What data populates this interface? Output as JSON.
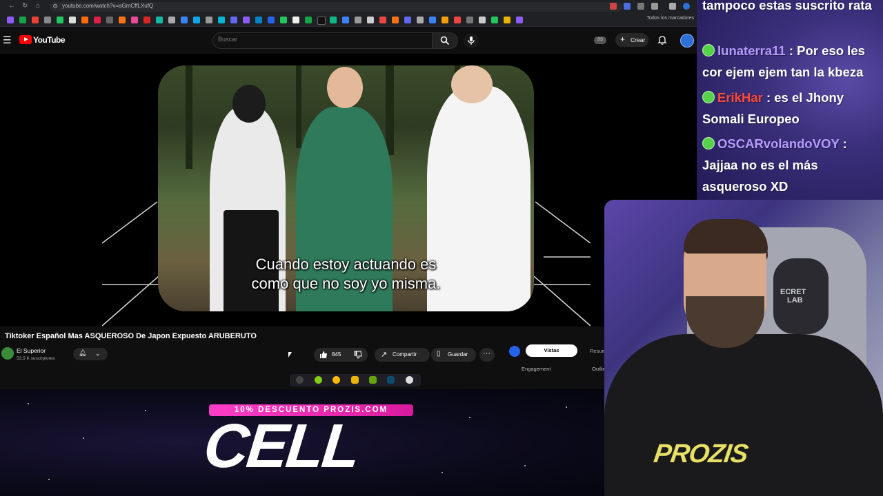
{
  "browser": {
    "url": "youtube.com/watch?v=aGmCffLXufQ",
    "bookmarks_label": "Todos los marcadores"
  },
  "youtube": {
    "logo_text": "YouTube",
    "search_placeholder": "Buscar",
    "ss_badge": "SS",
    "create_label": "Crear"
  },
  "video": {
    "subtitle_line1": "Cuando estoy actuando es",
    "subtitle_line2": "como que no soy yo misma.",
    "title": "Tiktoker Español Mas ASQUEROSO De Japon Expuesto ARUBERUTO"
  },
  "channel": {
    "name": "El Superior",
    "subscribers": "53,5 K suscriptores"
  },
  "actions": {
    "likes": "845",
    "share_label": "Compartir",
    "save_label": "Guardar"
  },
  "side_panel": {
    "tab_active": "Vistas",
    "tab_other": "Resum",
    "engagement": "Engagement",
    "outline": "Outlie"
  },
  "chat": {
    "messages": [
      {
        "user": "",
        "text": "tampoco estas suscrito rata",
        "color": "#ffffff"
      },
      {
        "user": "lunaterra11",
        "text": ": Por eso les cor ejem ejem tan la kbeza",
        "color": "#b59cff"
      },
      {
        "user": "ErikHar",
        "text": ": es el Jhony Somali Europeo",
        "color": "#ff4a3a"
      },
      {
        "user": "OSCARvolandoVOY",
        "text": ": Jajjaa no es el más asqueroso XD",
        "color": "#b59cff"
      }
    ]
  },
  "webcam": {
    "shirt_text": "PROZIS",
    "chair_text_1": "ECRET",
    "chair_text_2": "LAB"
  },
  "promo": {
    "banner": "10% DESCUENTO PROZIS.COM",
    "product": "CELL"
  }
}
